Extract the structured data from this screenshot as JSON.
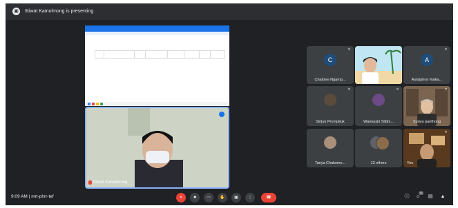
{
  "presenting_bar": {
    "text": "Ittiwat Kamolmong is presenting"
  },
  "presenter": {
    "name": "Ittiwat Kamolmong"
  },
  "participants": [
    {
      "name": "Chattree Ngamp...",
      "initial": "C",
      "color": "#1f4c7a"
    },
    {
      "name": "",
      "initial": "",
      "color": "#f7e6c4"
    },
    {
      "name": "Autaiphon Kaika...",
      "initial": "A",
      "color": "#1f4c7a"
    },
    {
      "name": "Sirijun Prompituk",
      "initial": "",
      "color": "#5b4b3c"
    },
    {
      "name": "Wannasiri Sittini...",
      "initial": "",
      "color": "#6b4a86"
    },
    {
      "name": "Suriya panthong",
      "initial": "",
      "color": "#8a6b4b"
    },
    {
      "name": "Tanya Chakome...",
      "initial": "",
      "color": "#a8907a"
    },
    {
      "name": "13 others",
      "initial": "",
      "color": "#5f6368"
    },
    {
      "name": "You",
      "initial": "",
      "color": "#6a4a2a"
    }
  ],
  "meeting": {
    "time": "9:09 AM",
    "separator": "|",
    "code": "mrt-phrr-tef"
  },
  "controls": {
    "raise_hand_badge": "13"
  }
}
